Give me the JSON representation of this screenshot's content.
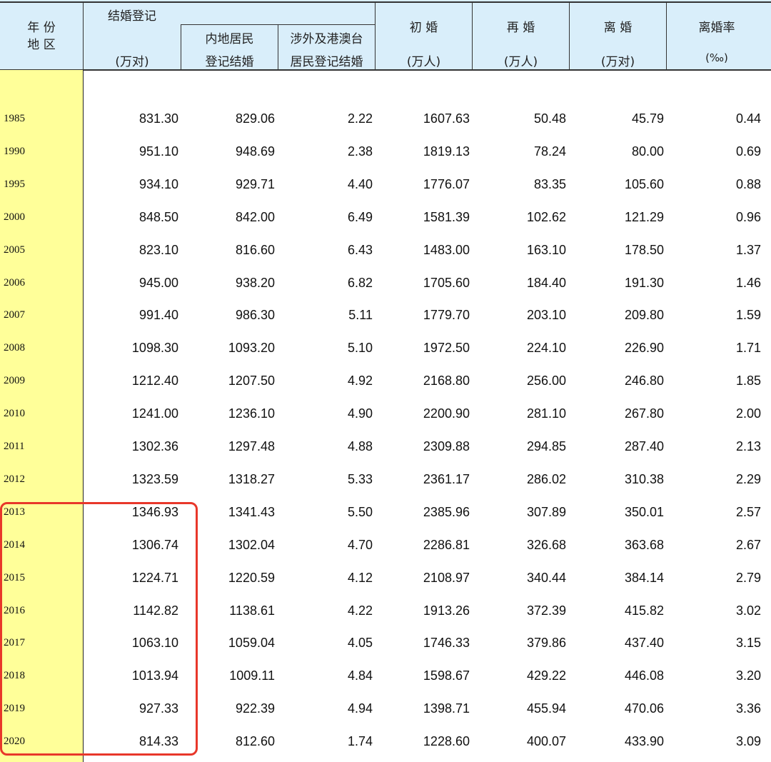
{
  "chart_data": {
    "type": "table",
    "header": {
      "year_region": [
        "年 份",
        "地 区"
      ],
      "marriage_registration": "结婚登记",
      "marriage_unit": "(万对)",
      "mainland": [
        "内地居民",
        "登记结婚"
      ],
      "foreign": [
        "涉外及港澳台",
        "居民登记结婚"
      ],
      "first_marriage": "初 婚",
      "first_unit": "(万人)",
      "remarriage": "再 婚",
      "remarriage_unit": "(万人)",
      "divorce": "离 婚",
      "divorce_unit": "(万对)",
      "divorce_rate": "离婚率",
      "rate_unit": "(‰)"
    },
    "columns": [
      "year",
      "marriage_registration",
      "mainland",
      "foreign",
      "first_marriage",
      "remarriage",
      "divorce",
      "divorce_rate"
    ],
    "rows": [
      [
        "1985",
        "831.30",
        "829.06",
        "2.22",
        "1607.63",
        "50.48",
        "45.79",
        "0.44"
      ],
      [
        "1990",
        "951.10",
        "948.69",
        "2.38",
        "1819.13",
        "78.24",
        "80.00",
        "0.69"
      ],
      [
        "1995",
        "934.10",
        "929.71",
        "4.40",
        "1776.07",
        "83.35",
        "105.60",
        "0.88"
      ],
      [
        "2000",
        "848.50",
        "842.00",
        "6.49",
        "1581.39",
        "102.62",
        "121.29",
        "0.96"
      ],
      [
        "2005",
        "823.10",
        "816.60",
        "6.43",
        "1483.00",
        "163.10",
        "178.50",
        "1.37"
      ],
      [
        "2006",
        "945.00",
        "938.20",
        "6.82",
        "1705.60",
        "184.40",
        "191.30",
        "1.46"
      ],
      [
        "2007",
        "991.40",
        "986.30",
        "5.11",
        "1779.70",
        "203.10",
        "209.80",
        "1.59"
      ],
      [
        "2008",
        "1098.30",
        "1093.20",
        "5.10",
        "1972.50",
        "224.10",
        "226.90",
        "1.71"
      ],
      [
        "2009",
        "1212.40",
        "1207.50",
        "4.92",
        "2168.80",
        "256.00",
        "246.80",
        "1.85"
      ],
      [
        "2010",
        "1241.00",
        "1236.10",
        "4.90",
        "2200.90",
        "281.10",
        "267.80",
        "2.00"
      ],
      [
        "2011",
        "1302.36",
        "1297.48",
        "4.88",
        "2309.88",
        "294.85",
        "287.40",
        "2.13"
      ],
      [
        "2012",
        "1323.59",
        "1318.27",
        "5.33",
        "2361.17",
        "286.02",
        "310.38",
        "2.29"
      ],
      [
        "2013",
        "1346.93",
        "1341.43",
        "5.50",
        "2385.96",
        "307.89",
        "350.01",
        "2.57"
      ],
      [
        "2014",
        "1306.74",
        "1302.04",
        "4.70",
        "2286.81",
        "326.68",
        "363.68",
        "2.67"
      ],
      [
        "2015",
        "1224.71",
        "1220.59",
        "4.12",
        "2108.97",
        "340.44",
        "384.14",
        "2.79"
      ],
      [
        "2016",
        "1142.82",
        "1138.61",
        "4.22",
        "1913.26",
        "372.39",
        "415.82",
        "3.02"
      ],
      [
        "2017",
        "1063.10",
        "1059.04",
        "4.05",
        "1746.33",
        "379.86",
        "437.40",
        "3.15"
      ],
      [
        "2018",
        "1013.94",
        "1009.11",
        "4.84",
        "1598.67",
        "429.22",
        "446.08",
        "3.20"
      ],
      [
        "2019",
        "927.33",
        "922.39",
        "4.94",
        "1398.71",
        "455.94",
        "470.06",
        "3.36"
      ],
      [
        "2020",
        "814.33",
        "812.60",
        "1.74",
        "1228.60",
        "400.07",
        "433.90",
        "3.09"
      ]
    ],
    "highlight": {
      "rows": [
        "2013",
        "2020"
      ],
      "column": "marriage_registration",
      "color": "#e8372a"
    }
  },
  "colors": {
    "header_bg": "#d9eefa",
    "year_col_bg": "#ffff99",
    "highlight": "#e8372a"
  }
}
